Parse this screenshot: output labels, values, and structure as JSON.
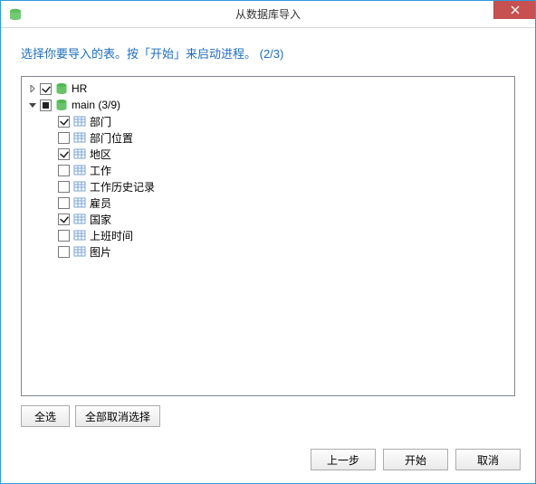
{
  "window": {
    "title": "从数据库导入"
  },
  "instruction": "选择你要导入的表。按「开始」来启动进程。 (2/3)",
  "tree": {
    "databases": [
      {
        "name": "HR",
        "expanded": false,
        "state": "checked",
        "tables": []
      },
      {
        "name": "main",
        "count_label": "(3/9)",
        "expanded": true,
        "state": "mixed",
        "tables": [
          {
            "name": "部门",
            "checked": true
          },
          {
            "name": "部门位置",
            "checked": false
          },
          {
            "name": "地区",
            "checked": true
          },
          {
            "name": "工作",
            "checked": false
          },
          {
            "name": "工作历史记录",
            "checked": false
          },
          {
            "name": "雇员",
            "checked": false
          },
          {
            "name": "国家",
            "checked": true
          },
          {
            "name": "上班时间",
            "checked": false
          },
          {
            "name": "图片",
            "checked": false
          }
        ]
      }
    ]
  },
  "buttons": {
    "select_all": "全选",
    "deselect_all": "全部取消选择",
    "back": "上一步",
    "start": "开始",
    "cancel": "取消"
  }
}
